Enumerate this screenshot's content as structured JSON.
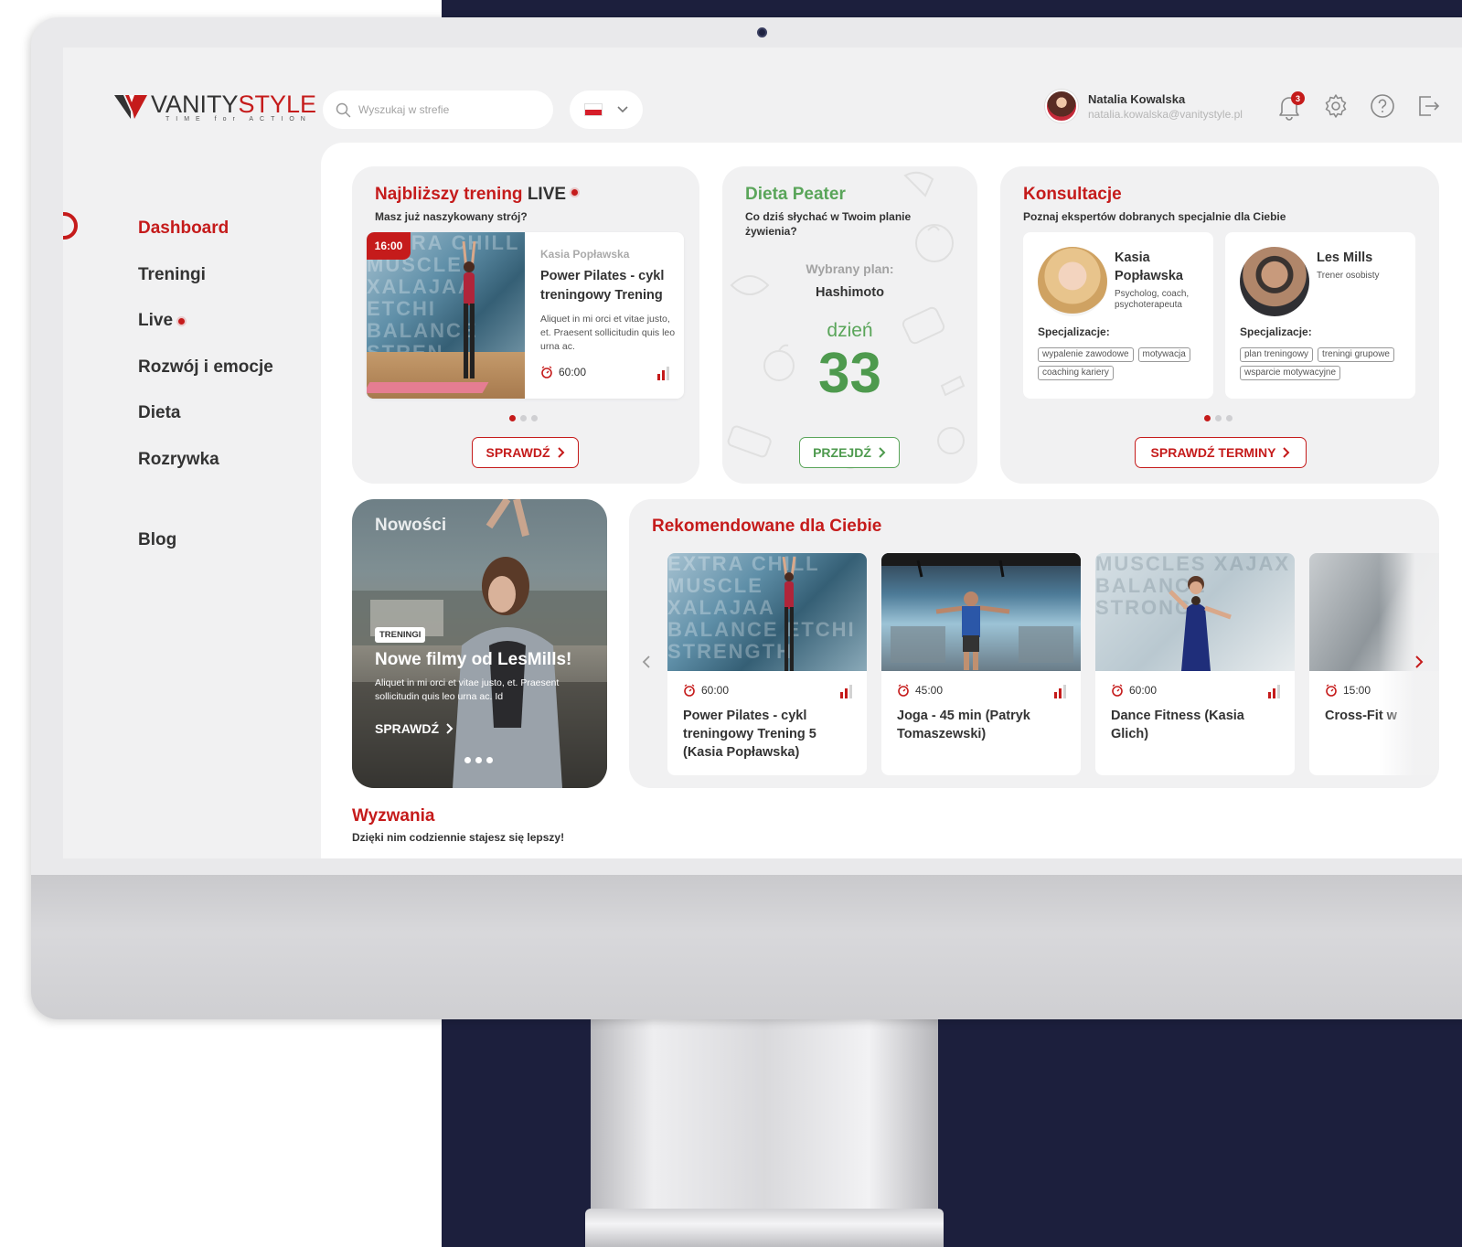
{
  "header": {
    "logo_word_1": "VANITY",
    "logo_word_2": "STYLE",
    "logo_tagline": "TIME for ACTION",
    "search_placeholder": "Wyszukaj w strefie",
    "language_flag": "pl-flag-icon",
    "user": {
      "name": "Natalia Kowalska",
      "email": "natalia.kowalska@vanitystyle.pl"
    },
    "notifications_count": "3"
  },
  "sidebar": {
    "items": [
      {
        "label": "Dashboard",
        "active": true
      },
      {
        "label": "Treningi"
      },
      {
        "label": "Live",
        "live": true
      },
      {
        "label": "Rozwój i emocje"
      },
      {
        "label": "Dieta"
      },
      {
        "label": "Rozrywka"
      },
      {
        "label": "Blog"
      }
    ]
  },
  "live": {
    "title_1": "Najbliższy trening ",
    "title_2": "LIVE",
    "subtitle": "Masz już naszykowany strój?",
    "time": "16:00",
    "author": "Kasia Popławska",
    "name": "Power Pilates - cykl treningowy Trening",
    "description": "Aliquet in mi orci et vitae justo, et. Praesent sollicitudin quis leo urna ac.",
    "duration": "60:00",
    "button": "SPRAWDŹ"
  },
  "diet": {
    "title": "Dieta Peater",
    "subtitle": "Co dziś słychać w Twoim planie żywienia?",
    "plan_label": "Wybrany plan:",
    "plan_value": "Hashimoto",
    "day_label": "dzień",
    "day_value": "33",
    "button": "PRZEJDŹ"
  },
  "consult": {
    "title": "Konsultacje",
    "subtitle": "Poznaj ekspertów dobranych specjalnie dla Ciebie",
    "spec_label": "Specjalizacje:",
    "experts": [
      {
        "name": "Kasia Popławska",
        "role": "Psycholog, coach, psychoterapeuta",
        "tags": [
          "wypalenie zawodowe",
          "motywacja",
          "coaching kariery"
        ]
      },
      {
        "name": "Les Mills",
        "role": "Trener osobisty",
        "tags": [
          "plan treningowy",
          "treningi grupowe",
          "wsparcie motywacyjne"
        ]
      }
    ],
    "button": "SPRAWDŹ TERMINY"
  },
  "news": {
    "title": "Nowości",
    "badge": "TRENINGI",
    "headline": "Nowe filmy od LesMills!",
    "description": "Aliquet in mi orci et vitae justo, et. Praesent sollicitudin quis leo urna ac. Id",
    "link": "SPRAWDŹ"
  },
  "recommended": {
    "title": "Rekomendowane dla Ciebie",
    "items": [
      {
        "duration": "60:00",
        "title": "Power Pilates - cykl treningowy Trening 5 (Kasia Popławska)"
      },
      {
        "duration": "45:00",
        "title": "Joga - 45 min (Patryk Tomaszewski)"
      },
      {
        "duration": "60:00",
        "title": "Dance Fitness (Kasia Glich)"
      },
      {
        "duration": "15:00",
        "title": "Cross-Fit w"
      }
    ]
  },
  "challenges": {
    "title": "Wyzwania",
    "subtitle": "Dzięki nim codziennie stajesz się lepszy!"
  },
  "colors": {
    "accent": "#c51b1b",
    "diet_green": "#5aa55a",
    "navy": "#1c1f3d"
  }
}
